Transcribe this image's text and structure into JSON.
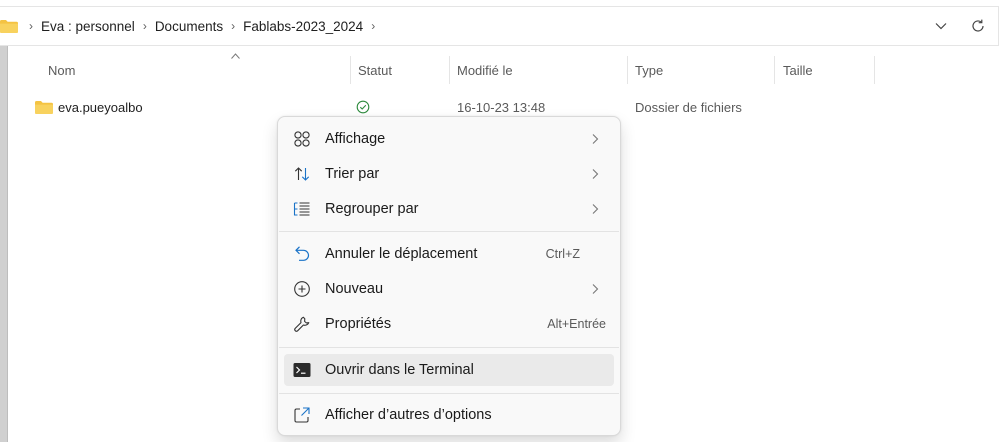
{
  "address_bar": {
    "breadcrumbs": [
      "Eva : personnel",
      "Documents",
      "Fablabs-2023_2024"
    ],
    "separator": "›",
    "dropdown_icon": "chevron-down-icon",
    "refresh_icon": "refresh-icon"
  },
  "columns": {
    "name": "Nom",
    "status": "Statut",
    "modified": "Modifié le",
    "type": "Type",
    "size": "Taille"
  },
  "files": [
    {
      "name": "eva.pueyoalbo",
      "status_icon": "synced-check-icon",
      "modified": "16-10-23 13:48",
      "type": "Dossier de fichiers",
      "size": ""
    }
  ],
  "context_menu": {
    "items": [
      {
        "label": "Affichage",
        "icon": "view-grid-icon",
        "submenu": true,
        "shortcut": ""
      },
      {
        "label": "Trier par",
        "icon": "sort-icon",
        "submenu": true,
        "shortcut": ""
      },
      {
        "label": "Regrouper par",
        "icon": "group-list-icon",
        "submenu": true,
        "shortcut": ""
      },
      {
        "label": "Annuler le déplacement",
        "icon": "undo-icon",
        "submenu": false,
        "shortcut": "Ctrl+Z"
      },
      {
        "label": "Nouveau",
        "icon": "add-circle-icon",
        "submenu": true,
        "shortcut": ""
      },
      {
        "label": "Propriétés",
        "icon": "wrench-icon",
        "submenu": false,
        "shortcut": "Alt+Entrée"
      },
      {
        "label": "Ouvrir dans le Terminal",
        "icon": "terminal-icon",
        "submenu": false,
        "shortcut": "",
        "highlighted": true
      },
      {
        "label": "Afficher d’autres d’options",
        "icon": "share-icon",
        "submenu": false,
        "shortcut": ""
      }
    ]
  },
  "colors": {
    "folder": "#f4c343",
    "accent_blue": "#1a73c8",
    "synced_green": "#2e8b3e",
    "menu_background": "#f9f9f9",
    "highlight": "#eaeaea"
  }
}
